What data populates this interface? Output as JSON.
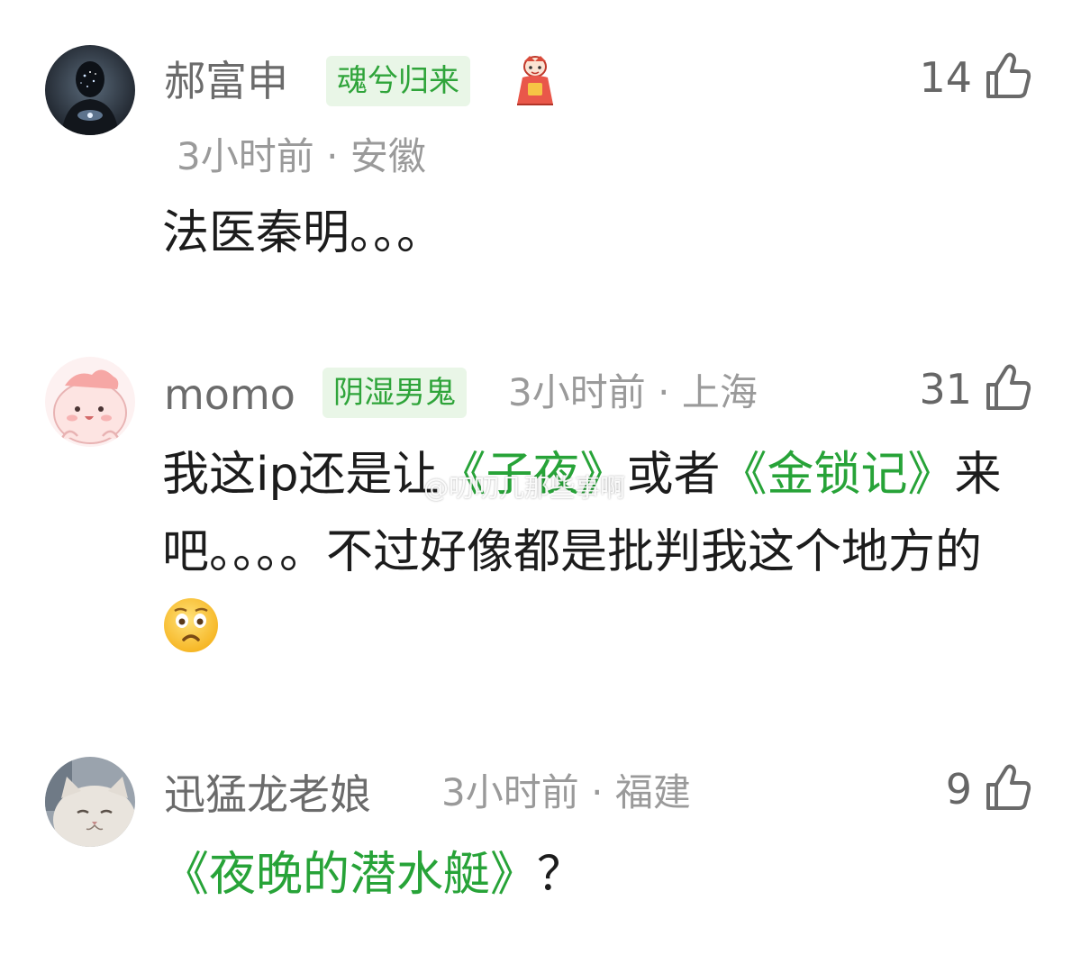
{
  "comments": [
    {
      "username": "郝富申",
      "badge": "魂兮归来",
      "time": "3小时前",
      "location": "安徽",
      "likes": "14",
      "text": "法医秦明。。。"
    },
    {
      "username": "momo",
      "badge": "阴湿男鬼",
      "time": "3小时前",
      "location": "上海",
      "likes": "31",
      "text_part1": "我这ip还是让",
      "book1": "《子夜》",
      "text_part2": "或者",
      "book2": "《金锁记》",
      "text_part3": "来吧。。。。不过好像都是批判我这个地方的",
      "emoji": "worried-face-emoji"
    },
    {
      "username": "迅猛龙老娘",
      "time": "3小时前",
      "location": "福建",
      "likes": "9",
      "book": "《夜晚的潜水艇》",
      "text_after": "？"
    }
  ],
  "separator": "·",
  "watermark": "@叨叨几那些事啊",
  "colors": {
    "highlight": "#27a338",
    "badge_bg": "#e9f6e7",
    "meta": "#9a9a9a",
    "username": "#6b6b6b"
  },
  "icons": [
    "thumb-up-icon",
    "avatar-image",
    "pendant-icon",
    "worried-face-emoji"
  ]
}
